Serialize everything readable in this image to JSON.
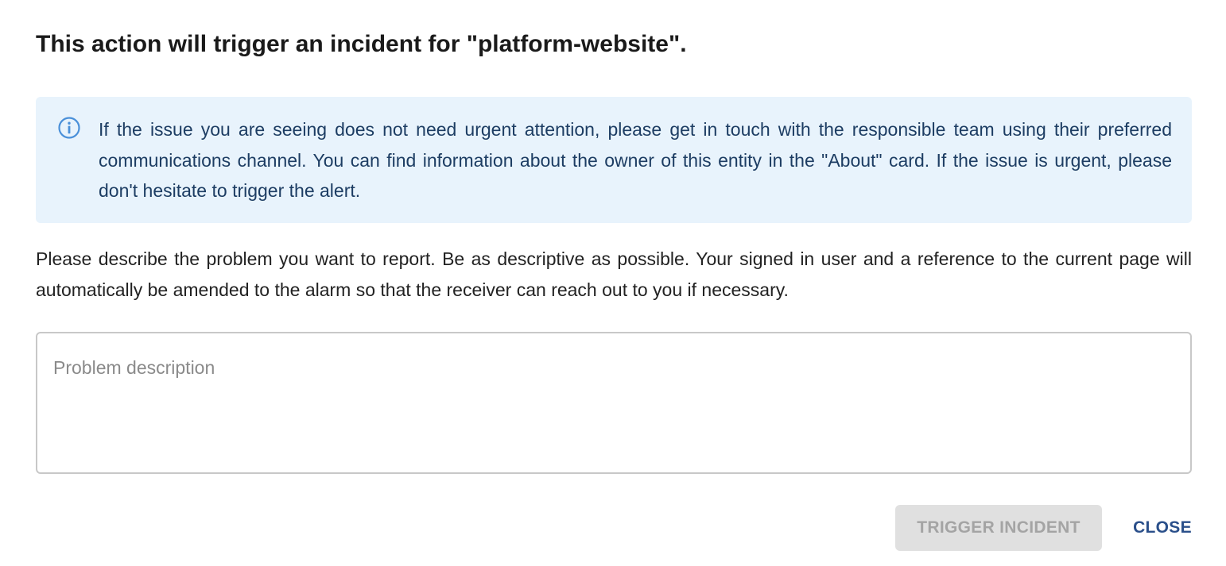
{
  "dialog": {
    "title": "This action will trigger an incident for \"platform-website\".",
    "alert": {
      "icon": "info-icon",
      "text": "If the issue you are seeing does not need urgent attention, please get in touch with the responsible team using their preferred communications channel. You can find information about the owner of this entity in the \"About\" card. If the issue is urgent, please don't hesitate to trigger the alert."
    },
    "description": "Please describe the problem you want to report. Be as descriptive as possible. Your signed in user and a reference to the current page will automatically be amended to the alarm so that the receiver can reach out to you if necessary.",
    "problem_field": {
      "value": "",
      "placeholder": "Problem description"
    },
    "actions": {
      "trigger_label": "TRIGGER INCIDENT",
      "trigger_disabled": true,
      "close_label": "CLOSE"
    }
  },
  "colors": {
    "alert_background": "#e8f3fc",
    "alert_text": "#1d3d63",
    "info_icon": "#4a90d9",
    "close_button": "#2a4f8a",
    "disabled_button_bg": "#e0e0e0",
    "disabled_button_text": "#a4a4a4"
  }
}
